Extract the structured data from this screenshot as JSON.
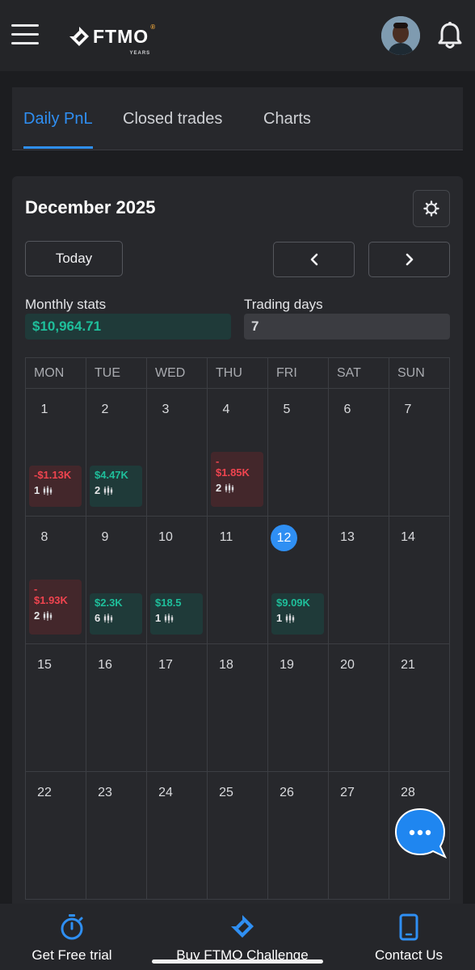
{
  "header": {
    "logo_text": "FTMO",
    "logo_subtext": "YEARS",
    "icons": {
      "menu": "hamburger-icon",
      "notifications": "bell-icon",
      "avatar": "user-avatar"
    }
  },
  "tabs": [
    {
      "label": "Daily PnL",
      "active": true
    },
    {
      "label": "Closed trades",
      "active": false
    },
    {
      "label": "Charts",
      "active": false
    }
  ],
  "calendar": {
    "month_title": "December 2025",
    "today_label": "Today",
    "prev_icon": "chevron-left-icon",
    "next_icon": "chevron-right-icon",
    "settings_icon": "gear-icon",
    "monthly_stats_label": "Monthly stats",
    "monthly_stats_value": "$10,964.71",
    "trading_days_label": "Trading days",
    "trading_days_value": "7",
    "weekdays": [
      "MON",
      "TUE",
      "WED",
      "THU",
      "FRI",
      "SAT",
      "SUN"
    ],
    "weeks": [
      [
        {
          "day": "1",
          "pnl": "-$1.13K",
          "trades": "1",
          "result": "loss"
        },
        {
          "day": "2",
          "pnl": "$4.47K",
          "trades": "2",
          "result": "win"
        },
        {
          "day": "3"
        },
        {
          "day": "4",
          "pnl": "-\n$1.85K",
          "trades": "2",
          "result": "loss"
        },
        {
          "day": "5"
        },
        {
          "day": "6"
        },
        {
          "day": "7"
        }
      ],
      [
        {
          "day": "8",
          "pnl": "-\n$1.93K",
          "trades": "2",
          "result": "loss"
        },
        {
          "day": "9",
          "pnl": "$2.3K",
          "trades": "6",
          "result": "win"
        },
        {
          "day": "10",
          "pnl": "$18.5",
          "trades": "1",
          "result": "win"
        },
        {
          "day": "11"
        },
        {
          "day": "12",
          "today": true,
          "pnl": "$9.09K",
          "trades": "1",
          "result": "win"
        },
        {
          "day": "13"
        },
        {
          "day": "14"
        }
      ],
      [
        {
          "day": "15"
        },
        {
          "day": "16"
        },
        {
          "day": "17"
        },
        {
          "day": "18"
        },
        {
          "day": "19"
        },
        {
          "day": "20"
        },
        {
          "day": "21"
        }
      ],
      [
        {
          "day": "22"
        },
        {
          "day": "23"
        },
        {
          "day": "24"
        },
        {
          "day": "25"
        },
        {
          "day": "26"
        },
        {
          "day": "27"
        },
        {
          "day": "28"
        }
      ]
    ]
  },
  "chat": {
    "icon": "chat-bubble-icon"
  },
  "bottom_nav": [
    {
      "label": "Get Free trial",
      "icon": "stopwatch-icon"
    },
    {
      "label": "Buy FTMO Challenge",
      "icon": "ftmo-logo-icon"
    },
    {
      "label": "Contact Us",
      "icon": "phone-icon"
    }
  ],
  "colors": {
    "accent": "#2f8ff3",
    "profit": "#1fbf9b",
    "loss": "#f0444f",
    "background": "#1c1d20",
    "panel": "#27282c"
  }
}
